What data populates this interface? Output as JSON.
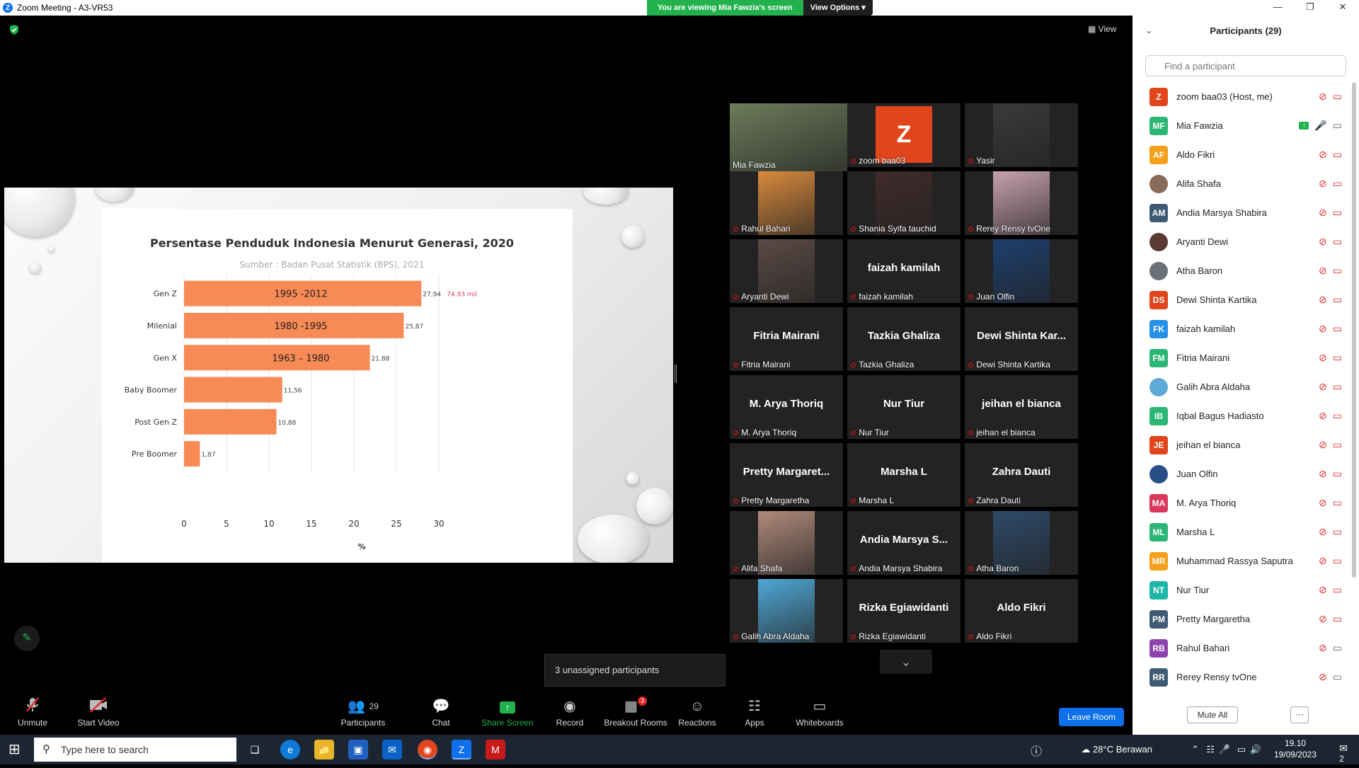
{
  "window": {
    "title": "Zoom Meeting - A3-VR53",
    "minimize": "—",
    "maximize": "❐",
    "close": "✕"
  },
  "banner": {
    "viewing": "You are viewing Mia Fawzia's screen",
    "view_options": "View Options"
  },
  "view_label": "View",
  "colors": {
    "zoom_blue": "#0e71eb",
    "accent_green": "#22b14c",
    "muted_red": "#e02828",
    "bar_orange": "#f78a55"
  },
  "chart_data": {
    "type": "bar",
    "orientation": "horizontal",
    "title": "Persentase Penduduk Indonesia Menurut Generasi, 2020",
    "subtitle": "Sumber : Badan Pusat Statistik (BPS), 2021",
    "categories": [
      "Gen Z",
      "Milenial",
      "Gen X",
      "Baby Boomer",
      "Post Gen Z",
      "Pre Boomer"
    ],
    "values": [
      27.94,
      25.87,
      21.88,
      11.56,
      10.88,
      1.87
    ],
    "value_labels": [
      "27,94",
      "25,87",
      "21,88",
      "11,56",
      "10,88",
      "1,87"
    ],
    "bar_annotations": [
      "1995 -2012",
      "1980 -1995",
      "1963 – 1980",
      "",
      "",
      ""
    ],
    "side_note": "74.93 mil",
    "xlabel": "%",
    "xticks": [
      0,
      5,
      10,
      15,
      20,
      25,
      30
    ],
    "xlim": [
      0,
      30
    ],
    "grid": true
  },
  "gallery": [
    {
      "name": "Mia Fawzia",
      "kind": "video",
      "active": true,
      "muted": false
    },
    {
      "name": "zoom baa03",
      "kind": "initial",
      "initial": "Z",
      "muted": true
    },
    {
      "name": "Yasir",
      "kind": "video",
      "muted": true
    },
    {
      "name": "Rahul Bahari",
      "kind": "video",
      "muted": true
    },
    {
      "name": "Shania Syifa tauchid",
      "kind": "video",
      "muted": true
    },
    {
      "name": "Rerey Rensy tvOne",
      "kind": "video",
      "muted": true
    },
    {
      "name": "Aryanti Dewi",
      "kind": "video",
      "muted": true
    },
    {
      "name": "faizah kamilah",
      "kind": "text",
      "display": "faizah kamilah",
      "muted": true
    },
    {
      "name": "Juan Olfin",
      "kind": "video",
      "muted": true
    },
    {
      "name": "Fitria Mairani",
      "kind": "text",
      "display": "Fitria Mairani",
      "muted": true
    },
    {
      "name": "Tazkia Ghaliza",
      "kind": "text",
      "display": "Tazkia Ghaliza",
      "muted": true
    },
    {
      "name": "Dewi Shinta Kartika",
      "kind": "text",
      "display": "Dewi  Shinta  Kar...",
      "muted": true
    },
    {
      "name": "M. Arya Thoriq",
      "kind": "text",
      "display": "M. Arya Thoriq",
      "muted": true
    },
    {
      "name": "Nur Tiur",
      "kind": "text",
      "display": "Nur Tiur",
      "muted": true
    },
    {
      "name": "jeihan el bianca",
      "kind": "text",
      "display": "jeihan el bianca",
      "muted": true
    },
    {
      "name": "Pretty Margaretha",
      "kind": "text",
      "display": "Pretty  Margaret...",
      "muted": true
    },
    {
      "name": "Marsha L",
      "kind": "text",
      "display": "Marsha L",
      "muted": true
    },
    {
      "name": "Zahra Dauti",
      "kind": "text",
      "display": "Zahra Dauti",
      "muted": true
    },
    {
      "name": "Alifa Shafa",
      "kind": "video",
      "muted": true
    },
    {
      "name": "Andia Marsya Shabira",
      "kind": "text",
      "display": "Andia  Marsya  S...",
      "muted": true
    },
    {
      "name": "Atha Baron",
      "kind": "video",
      "muted": true
    },
    {
      "name": "Galih Abra Aldaha",
      "kind": "video",
      "muted": true
    },
    {
      "name": "Rizka Egiawidanti",
      "kind": "text",
      "display": "Rizka Egiawidanti",
      "muted": true
    },
    {
      "name": "Aldo Fikri",
      "kind": "text",
      "display": "Aldo Fikri",
      "muted": true
    }
  ],
  "unassigned": "3 unassigned participants",
  "toolbar": {
    "unmute": "Unmute",
    "start_video": "Start Video",
    "participants": "Participants",
    "participants_count": "29",
    "chat": "Chat",
    "share_screen": "Share Screen",
    "record": "Record",
    "breakout_rooms": "Breakout Rooms",
    "breakout_count": "3",
    "reactions": "Reactions",
    "apps": "Apps",
    "whiteboards": "Whiteboards",
    "leave_room": "Leave Room"
  },
  "panel": {
    "title": "Participants (29)",
    "search_placeholder": "Find a participant",
    "mute_all": "Mute All",
    "more": "···",
    "participants": [
      {
        "initials": "Z",
        "name": "zoom baa03 (Host, me)",
        "color": "#e0451c"
      },
      {
        "initials": "MF",
        "name": "Mia Fawzia",
        "color": "#2bb673",
        "sharing": true
      },
      {
        "initials": "AF",
        "name": "Aldo Fikri",
        "color": "#f3a11a"
      },
      {
        "initials": "",
        "name": "Alifa Shafa",
        "color": "#8a6b5a",
        "photo": true
      },
      {
        "initials": "AM",
        "name": "Andia Marsya Shabira",
        "color": "#3f5b74"
      },
      {
        "initials": "",
        "name": "Aryanti Dewi",
        "color": "#5a3b34",
        "photo": true
      },
      {
        "initials": "",
        "name": "Atha Baron",
        "color": "#6b6f78",
        "photo": true
      },
      {
        "initials": "DS",
        "name": "Dewi Shinta Kartika",
        "color": "#e0451c"
      },
      {
        "initials": "FK",
        "name": "faizah kamilah",
        "color": "#2590e6"
      },
      {
        "initials": "FM",
        "name": "Fitria Mairani",
        "color": "#2bb673"
      },
      {
        "initials": "",
        "name": "Galih Abra Aldaha",
        "color": "#5fa9d6",
        "photo": true
      },
      {
        "initials": "IB",
        "name": "Iqbal Bagus Hadiasto",
        "color": "#2bb673"
      },
      {
        "initials": "JE",
        "name": "jeihan el bianca",
        "color": "#e0451c"
      },
      {
        "initials": "",
        "name": "Juan Olfin",
        "color": "#2a4f86",
        "photo": true
      },
      {
        "initials": "MA",
        "name": "M. Arya Thoriq",
        "color": "#d9385b"
      },
      {
        "initials": "ML",
        "name": "Marsha L",
        "color": "#2bb673"
      },
      {
        "initials": "MR",
        "name": "Muhammad Rassya Saputra",
        "color": "#f3a11a"
      },
      {
        "initials": "NT",
        "name": "Nur Tiur",
        "color": "#1fb5a8"
      },
      {
        "initials": "PM",
        "name": "Pretty Margaretha",
        "color": "#3f5b74"
      },
      {
        "initials": "RB",
        "name": "Rahul Bahari",
        "color": "#8e44ad",
        "video_on": true
      },
      {
        "initials": "RR",
        "name": "Rerey Rensy tvOne",
        "color": "#3f5b74",
        "video_on": true
      }
    ]
  },
  "taskbar": {
    "search_placeholder": "Type here to search",
    "weather": "28°C  Berawan",
    "time": "19.10",
    "date": "19/09/2023",
    "notifications": "2"
  }
}
